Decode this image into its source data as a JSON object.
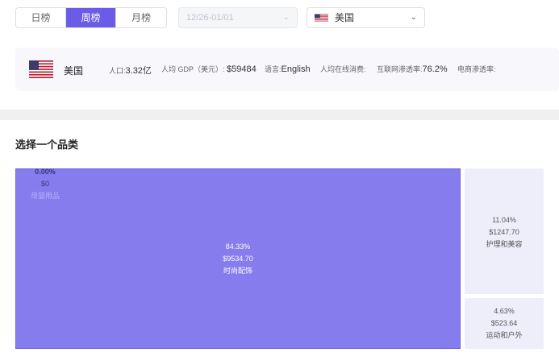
{
  "period_tabs": [
    {
      "label": "日榜",
      "active": false
    },
    {
      "label": "周榜",
      "active": true
    },
    {
      "label": "月榜",
      "active": false
    }
  ],
  "date_select": {
    "value": "12/26-01/01",
    "disabled": true
  },
  "country_select": {
    "value": "美国",
    "flag": "us-flag-icon"
  },
  "country_info": {
    "name": "美国",
    "population_label": "人口:",
    "population_value": "3.32亿",
    "gdp_label": "人均 GDP（美元）: ",
    "gdp_value": "$59484",
    "language_label": "语言:",
    "language_value": "English",
    "online_consumption_label": "人均在线消费:",
    "internet_penetration_label": "互联网渗透率:",
    "internet_penetration_value": "76.2%",
    "ecommerce_penetration_label": "电商渗透率:"
  },
  "section_title": "选择一个品类",
  "treemap": [
    {
      "percent": "84.33%",
      "amount": "$9534.70",
      "category": "时尚配饰"
    },
    {
      "percent": "11.04%",
      "amount": "$1247.70",
      "category": "护理和美容"
    },
    {
      "percent": "4.63%",
      "amount": "$523.64",
      "category": "运动和户外"
    },
    {
      "percent": "0.00%",
      "amount": "$0",
      "category": "母婴用品"
    }
  ],
  "colors": {
    "accent": "#6b5ce7",
    "primary_tile": "#857cee",
    "secondary_tile": "#eeeefb"
  }
}
